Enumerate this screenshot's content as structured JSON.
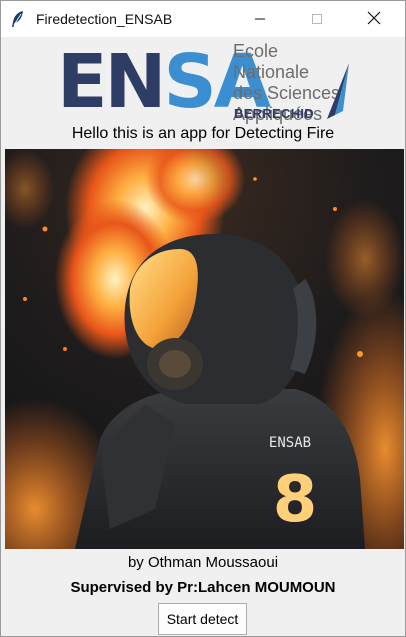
{
  "window": {
    "title": "Firedetection_ENSAB"
  },
  "logo": {
    "part1": "EN",
    "part2": "SA",
    "school_line1": "Ecole Nationale",
    "school_line2": "des Sciences",
    "school_line3": "Appliquées",
    "city": "BERRECHID"
  },
  "main": {
    "subtitle": "Hello this is an app for Detecting Fire",
    "jacket_text": "ENSAB",
    "jacket_number": "8",
    "author": "by Othman Moussaoui",
    "supervisor": "Supervised by Pr:Lahcen MOUMOUN",
    "start_button": "Start detect"
  },
  "colors": {
    "brand_dark": "#2e3d66",
    "brand_blue": "#3b8fd0",
    "fire": "#ff8a1e"
  },
  "icons": [
    "feather-icon",
    "minimize-icon",
    "maximize-icon",
    "close-icon"
  ]
}
